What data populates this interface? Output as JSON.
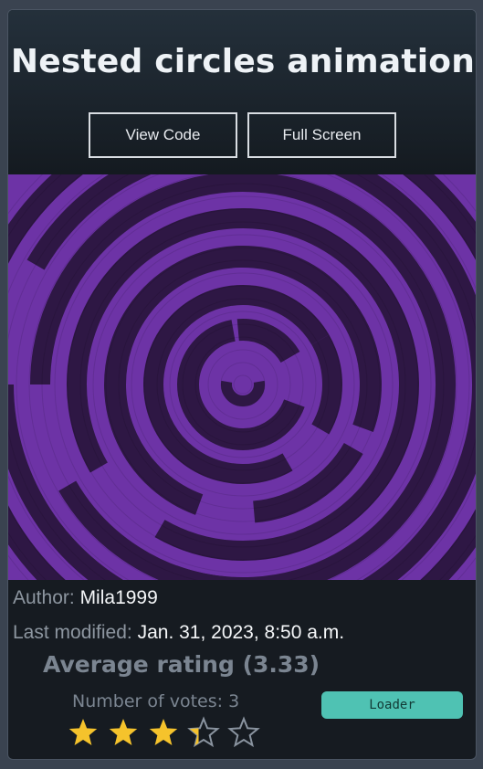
{
  "title": "Nested circles animation",
  "buttons": {
    "view_code": "View Code",
    "full_screen": "Full Screen"
  },
  "meta": {
    "author_label": "Author:",
    "author": "Mila1999",
    "modified_label": "Last modified:",
    "modified": "Jan. 31, 2023, 8:50 a.m."
  },
  "rating": {
    "average_text": "Average rating (3.33)",
    "votes_text": "Number of votes: 3",
    "average": 3.33,
    "max": 5
  },
  "tag": {
    "label": "Loader"
  },
  "colors": {
    "art_light": "#6d33a6",
    "art_dark": "#2e1744",
    "star_fill": "#f5c32c",
    "star_outline": "#8a94a0",
    "tag_bg": "#4fc2b3"
  }
}
